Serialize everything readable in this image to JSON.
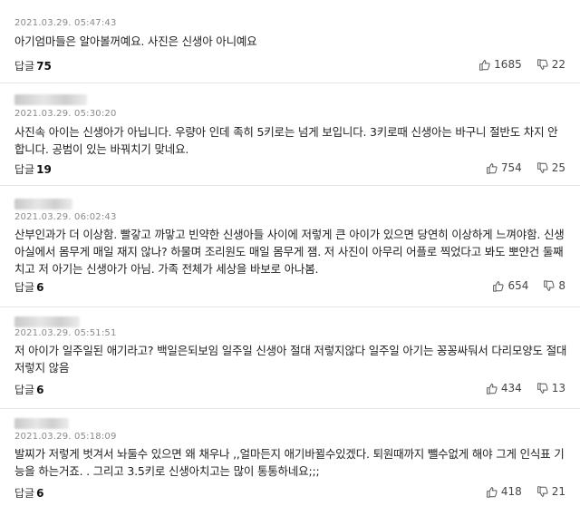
{
  "comments": [
    {
      "date": "2021.03.29. 05:47:43",
      "text": "아기엄마들은 알아볼꺼예요. 사진은 신생아 아니예요",
      "reply_label": "답글",
      "reply_count": "75",
      "likes": "1685",
      "dislikes": "22"
    },
    {
      "date": "2021.03.29. 05:30:20",
      "text": "사진속 아이는 신생아가 아닙니다. 우량아 인데 족히 5키로는 넘게 보입니다. 3키로때 신생아는 바구니 절반도 차지 안합니다. 공범이 있는 바꿔치기 맞네요.",
      "reply_label": "답글",
      "reply_count": "19",
      "likes": "754",
      "dislikes": "25"
    },
    {
      "date": "2021.03.29. 06:02:43",
      "text": "산부인과가 더 이상함. 빨갛고 까맣고 빈약한 신생아들 사이에 저렇게 큰 아이가 있으면 당연히 이상하게 느껴야함. 신생아실에서 몸무게 매일 재지 않나? 하물며 조리원도 매일 몸무게 잼. 저 사진이 아무리 어플로 찍었다고 봐도 뽀얀건 둘째치고 저 아기는 신생아가 아님. 가족 전체가 세상을 바보로 아나봄.",
      "reply_label": "답글",
      "reply_count": "6",
      "likes": "654",
      "dislikes": "8"
    },
    {
      "date": "2021.03.29. 05:51:51",
      "text": "저 아이가 일주일된 애기라고? 백일은되보임 일주일 신생아 절대 저렇지않다 일주일 아기는 꽁꽁싸둬서 다리모양도 절대 저렇지 않음",
      "reply_label": "답글",
      "reply_count": "6",
      "likes": "434",
      "dislikes": "13"
    },
    {
      "date": "2021.03.29. 05:18:09",
      "text": "발찌가 저렇게 벗겨서 놔둘수 있으면 왜 채우나 ,,얼마든지 애기바뀔수있겠다. 퇴원때까지 뺄수없게 해야 그게 인식표 기능을 하는거죠. . 그리고 3.5키로 신생아치고는 많이 통통하네요;;;",
      "reply_label": "답글",
      "reply_count": "6",
      "likes": "418",
      "dislikes": "21"
    }
  ]
}
